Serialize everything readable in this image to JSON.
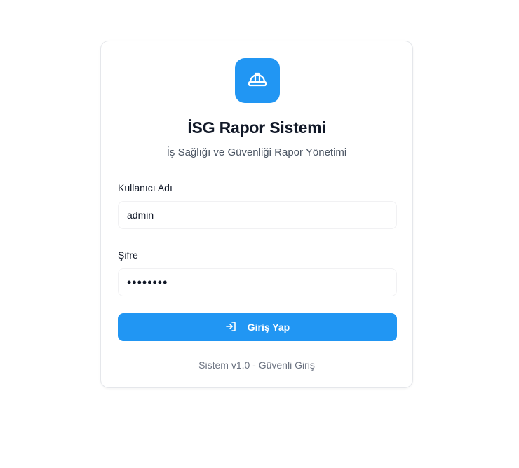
{
  "app": {
    "title": "İSG Rapor Sistemi",
    "subtitle": "İş Sağlığı ve Güvenliği Rapor Yönetimi",
    "logo_icon": "hard-hat-icon",
    "accent_color": "#2196f3"
  },
  "form": {
    "username": {
      "label": "Kullanıcı Adı",
      "value": "admin"
    },
    "password": {
      "label": "Şifre",
      "value": "••••••••"
    },
    "submit": {
      "label": "Giriş Yap",
      "icon": "login-icon"
    }
  },
  "footer": {
    "text": "Sistem v1.0 - Güvenli Giriş"
  }
}
